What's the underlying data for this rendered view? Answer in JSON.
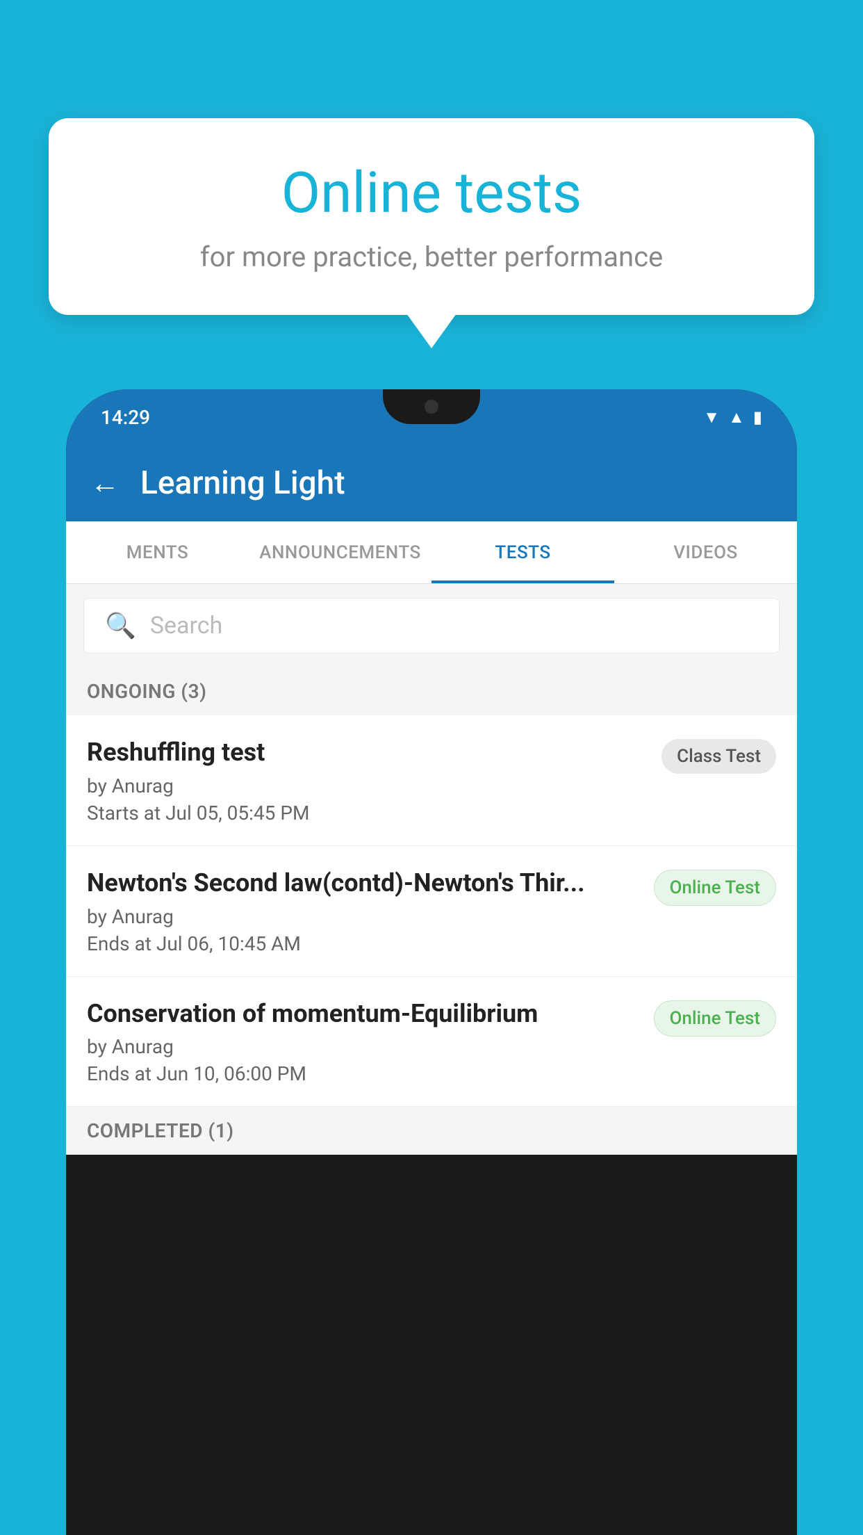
{
  "background": {
    "color": "#1ab3d8"
  },
  "speech_bubble": {
    "title": "Online tests",
    "subtitle": "for more practice, better performance"
  },
  "phone": {
    "status_bar": {
      "time": "14:29",
      "icons": [
        "wifi",
        "signal",
        "battery"
      ]
    },
    "app_header": {
      "title": "Learning Light",
      "back_label": "←"
    },
    "tabs": [
      {
        "label": "MENTS",
        "active": false
      },
      {
        "label": "ANNOUNCEMENTS",
        "active": false
      },
      {
        "label": "TESTS",
        "active": true
      },
      {
        "label": "VIDEOS",
        "active": false
      }
    ],
    "search": {
      "placeholder": "Search"
    },
    "ongoing_section": {
      "label": "ONGOING (3)"
    },
    "tests": [
      {
        "name": "Reshuffling test",
        "by": "by Anurag",
        "time": "Starts at  Jul 05, 05:45 PM",
        "badge": "Class Test",
        "badge_type": "class"
      },
      {
        "name": "Newton's Second law(contd)-Newton's Thir...",
        "by": "by Anurag",
        "time": "Ends at  Jul 06, 10:45 AM",
        "badge": "Online Test",
        "badge_type": "online"
      },
      {
        "name": "Conservation of momentum-Equilibrium",
        "by": "by Anurag",
        "time": "Ends at  Jun 10, 06:00 PM",
        "badge": "Online Test",
        "badge_type": "online"
      }
    ],
    "completed_section": {
      "label": "COMPLETED (1)"
    }
  }
}
